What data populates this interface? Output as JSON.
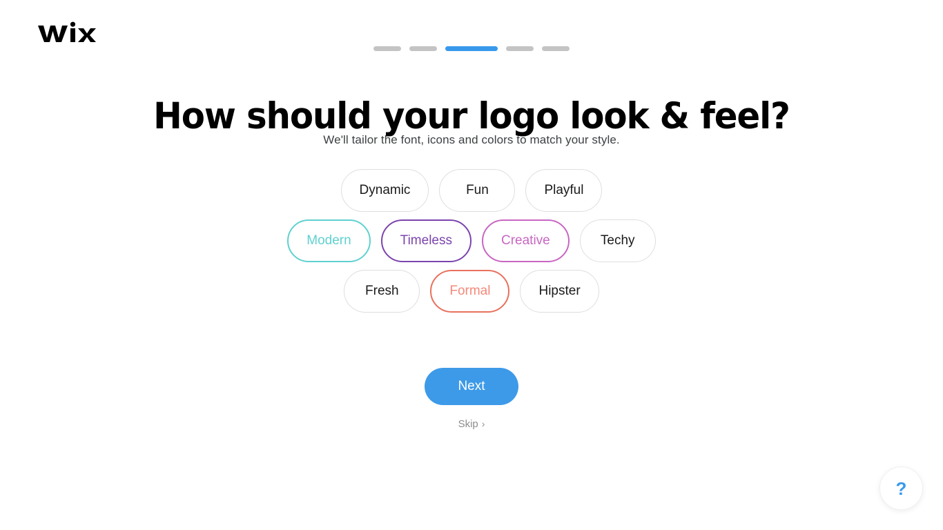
{
  "brand": {
    "name": "wix",
    "logo_icon": "wix-logo"
  },
  "progress": {
    "total_steps": 5,
    "current_step": 3,
    "active_color": "#3899ec",
    "inactive_color": "#c4c4c4"
  },
  "header": {
    "title": "How should your logo look & feel?",
    "subtitle": "We'll tailor the font, icons and colors to match your style."
  },
  "chips": {
    "rows": [
      [
        {
          "label": "Dynamic",
          "selected": false,
          "color": null
        },
        {
          "label": "Fun",
          "selected": false,
          "color": null
        },
        {
          "label": "Playful",
          "selected": false,
          "color": null
        }
      ],
      [
        {
          "label": "Modern",
          "selected": true,
          "color": "#5fd1ce"
        },
        {
          "label": "Timeless",
          "selected": true,
          "color": "#7b44ad"
        },
        {
          "label": "Creative",
          "selected": true,
          "color": "#c866c2"
        },
        {
          "label": "Techy",
          "selected": false,
          "color": null
        }
      ],
      [
        {
          "label": "Fresh",
          "selected": false,
          "color": null
        },
        {
          "label": "Formal",
          "selected": true,
          "color": "#e8705c",
          "text_color": "#f4897a"
        },
        {
          "label": "Hipster",
          "selected": false,
          "color": null
        }
      ]
    ]
  },
  "actions": {
    "next_label": "Next",
    "next_color": "#3d9ae8",
    "skip_label": "Skip",
    "skip_chevron": "›"
  },
  "help": {
    "glyph": "?",
    "color": "#3899ec"
  }
}
